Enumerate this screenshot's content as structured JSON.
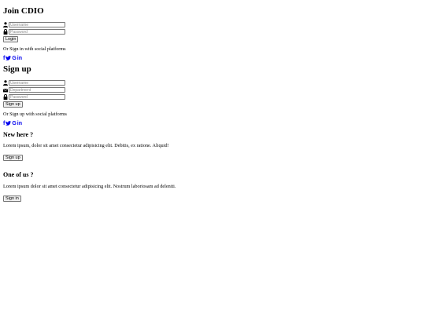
{
  "signin": {
    "title": "Join CDIO",
    "username_placeholder": "Username",
    "password_placeholder": "Password",
    "login_label": "Login",
    "social_text": "Or Sign in with social platforms"
  },
  "signup": {
    "title": "Sign up",
    "username_placeholder": "Username",
    "department_placeholder": "Department",
    "password_placeholder": "Password",
    "signup_label": "Sign up",
    "social_text": "Or Sign up with social platforms"
  },
  "social": {
    "facebook": "f",
    "google": "G",
    "linkedin": "in",
    "icons": [
      "facebook-icon",
      "twitter-icon",
      "google-icon",
      "linkedin-icon"
    ],
    "link_color": "#0000ee"
  },
  "panels": {
    "new_here": {
      "title": "New here ?",
      "text": "Lorem ipsum, dolor sit amet consectetur adipisicing elit. Debitis, ex ratione. Aliquid!",
      "button_label": "Sign up"
    },
    "one_of_us": {
      "title": "One of us ?",
      "text": "Lorem ipsum dolor sit amet consectetur adipisicing elit. Nostrum laboriosam ad deleniti.",
      "button_label": "Sign in"
    }
  }
}
